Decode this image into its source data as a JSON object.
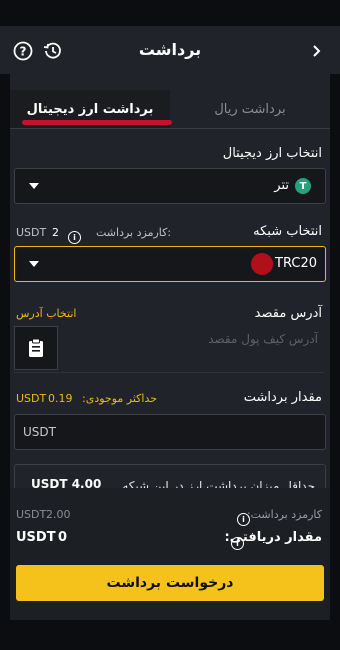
{
  "header": {
    "title": "برداشت"
  },
  "tabs": [
    {
      "label": "برداشت ارز دیجیتال"
    },
    {
      "label": "برداشت ریال"
    }
  ],
  "crypto": {
    "label": "انتخاب ارز دیجیتال",
    "value": "تتر",
    "icon_letter": "T"
  },
  "network": {
    "label": "انتخاب شبکه",
    "fee_label": "کارمزد برداشت:",
    "fee_value": "2",
    "fee_unit": "USDT",
    "value": "TRC20"
  },
  "address": {
    "label": "آدرس مقصد",
    "select_link": "انتخاب آدرس",
    "placeholder": "آدرس کیف پول مقصد"
  },
  "amount": {
    "label": "مقدار برداشت",
    "max_label": "حداکثر موجودی:",
    "max_value": "0.19",
    "max_unit": "USDT",
    "placeholder": "USDT"
  },
  "notice": {
    "text": "حداقل میزان برداشت ارز در این شبکه",
    "amount": "USDT 4.00"
  },
  "summary": {
    "fee_label": "کارمزد برداشت:",
    "fee_value": "2.00",
    "fee_unit": "USDT",
    "receive_label": "مقدار دریافتی:",
    "receive_value": "0",
    "receive_unit": "USDT"
  },
  "submit": {
    "label": "درخواست برداشت"
  },
  "colors": {
    "accent": "#f0b90b",
    "background": "#202329"
  }
}
